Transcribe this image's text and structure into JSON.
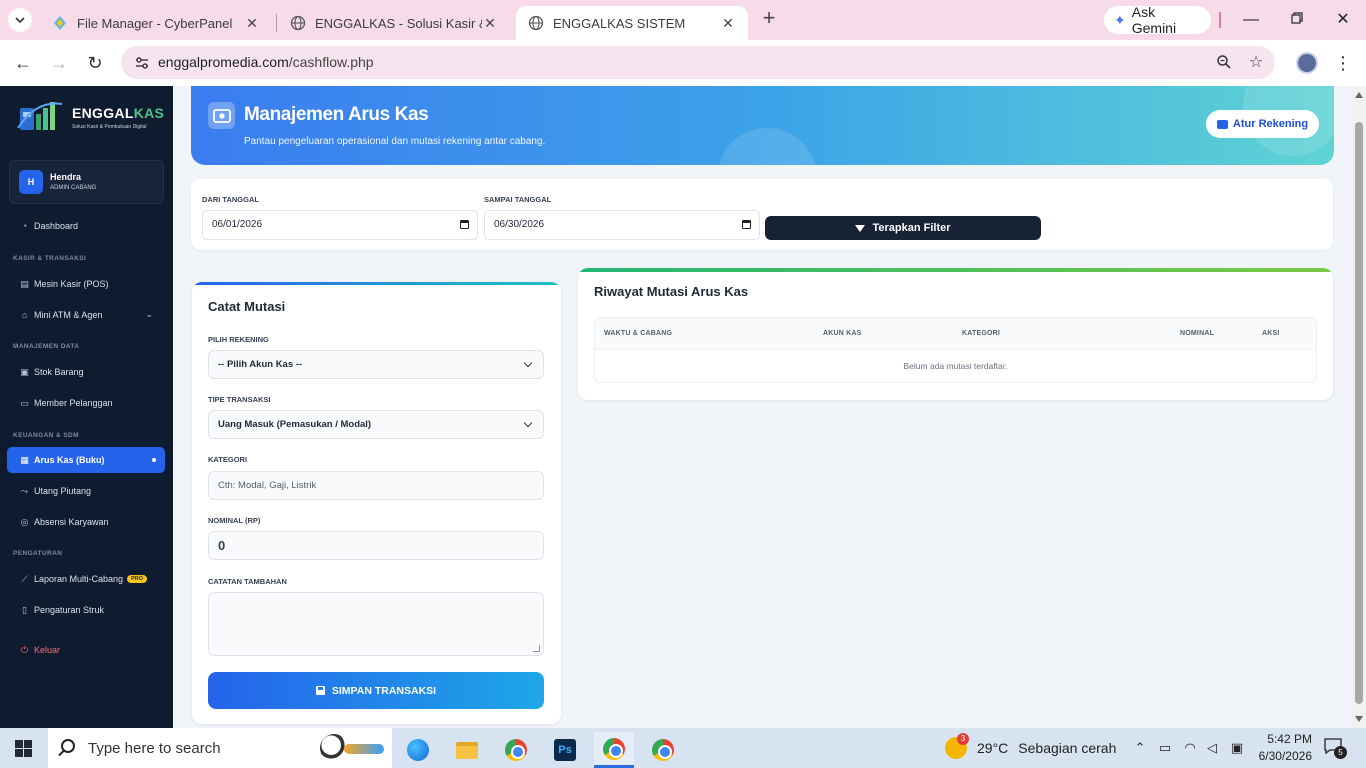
{
  "browser": {
    "tabs": [
      {
        "title": "File Manager - CyberPanel",
        "active": false
      },
      {
        "title": "ENGGALKAS - Solusi Kasir & Pe",
        "active": false
      },
      {
        "title": "ENGGALKAS SISTEM",
        "active": true
      }
    ],
    "new_tab": "+",
    "gemini_label": "Ask Gemini",
    "url_domain": "enggalpromedia.com",
    "url_path": "/cashflow.php"
  },
  "sidebar": {
    "logo_brand_a": "ENGGAL",
    "logo_brand_b": "KAS",
    "logo_tagline": "Solusi Kasir & Pembukuan Digital",
    "user": {
      "initial": "H",
      "name": "Hendra",
      "role": "ADMIN CABANG"
    },
    "sections": {
      "kasir": "KASIR & TRANSAKSI",
      "data": "MANAJEMEN DATA",
      "keuangan": "KEUANGAN & SDM",
      "pengaturan": "PENGATURAN"
    },
    "items": {
      "dashboard": "Dashboard",
      "pos": "Mesin Kasir (POS)",
      "atm": "Mini ATM & Agen",
      "stok": "Stok Barang",
      "member": "Member Pelanggan",
      "aruskas": "Arus Kas (Buku)",
      "utang": "Utang Piutang",
      "absensi": "Absensi Karyawan",
      "laporan": "Laporan Multi-Cabang",
      "laporan_badge": "PRO",
      "struk": "Pengaturan Struk",
      "keluar": "Keluar"
    }
  },
  "hero": {
    "title": "Manajemen Arus Kas",
    "subtitle": "Pantau pengeluaran operasional dan mutasi rekening antar cabang.",
    "button": "Atur Rekening"
  },
  "filter": {
    "from_label": "DARI TANGGAL",
    "from_value": "06/01/2026",
    "to_label": "SAMPAI TANGGAL",
    "to_value": "06/30/2026",
    "button": "Terapkan Filter"
  },
  "form": {
    "title": "Catat Mutasi",
    "rekening_label": "PILIH REKENING",
    "rekening_value": "-- Pilih Akun Kas --",
    "tipe_label": "TIPE TRANSAKSI",
    "tipe_value": "Uang Masuk (Pemasukan / Modal)",
    "kategori_label": "KATEGORI",
    "kategori_placeholder": "Cth: Modal, Gaji, Listrik",
    "nominal_label": "NOMINAL (RP)",
    "nominal_value": "0",
    "catatan_label": "CATATAN TAMBAHAN",
    "catatan_value": "",
    "submit": "SIMPAN TRANSAKSI"
  },
  "history": {
    "title": "Riwayat Mutasi Arus Kas",
    "columns": [
      "WAKTU & CABANG",
      "AKUN KAS",
      "KATEGORI",
      "NOMINAL",
      "AKSI"
    ],
    "empty": "Belum ada mutasi terdaftar."
  },
  "taskbar": {
    "search_placeholder": "Type here to search",
    "weather_temp": "29°C",
    "weather_desc": "Sebagian cerah",
    "weather_badge": "3",
    "time": "5:42 PM",
    "date": "6/30/2026",
    "notif_count": "5"
  },
  "colors": {
    "accent": "#2563eb",
    "sidebar_bg": "#0f1b2e",
    "tab_strip": "#f7dbe9",
    "logout": "#f2707a",
    "pro_badge": "#f5c518"
  }
}
